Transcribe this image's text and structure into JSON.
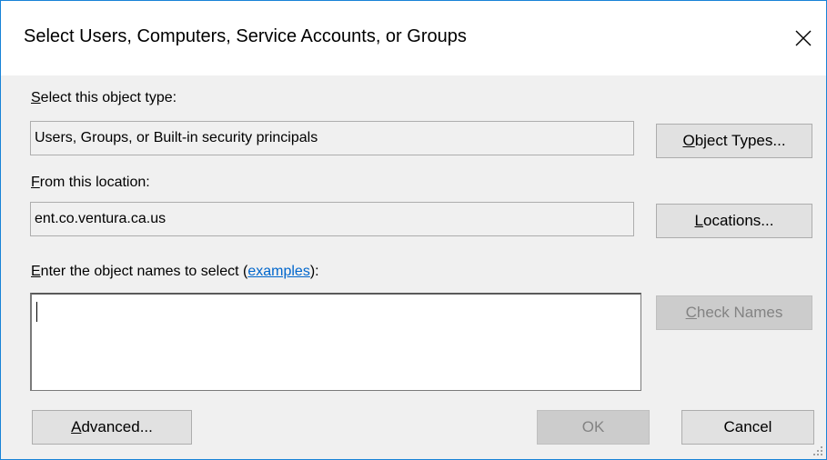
{
  "window": {
    "title": "Select Users, Computers, Service Accounts, or Groups"
  },
  "object_type": {
    "label_first": "S",
    "label_rest": "elect this object type:",
    "value": "Users, Groups, or Built-in security principals",
    "button_first": "O",
    "button_rest": "bject Types..."
  },
  "location": {
    "label_first": "F",
    "label_rest": "rom this location:",
    "value": "ent.co.ventura.ca.us",
    "button_first": "L",
    "button_rest": "ocations..."
  },
  "names": {
    "label_first": "E",
    "label_rest": "nter the object names to select (",
    "link": "examples",
    "label_end": "):",
    "value": "",
    "check_first": "C",
    "check_rest": "heck Names"
  },
  "footer": {
    "advanced_first": "A",
    "advanced_rest": "dvanced...",
    "ok_label": "OK",
    "cancel_label": "Cancel"
  },
  "icons": {
    "close": "close-icon",
    "resize": "resize-grip-icon"
  },
  "colors": {
    "window_border": "#1883d7",
    "link": "#0066cc",
    "dialog_bg": "#f0f0f0"
  }
}
